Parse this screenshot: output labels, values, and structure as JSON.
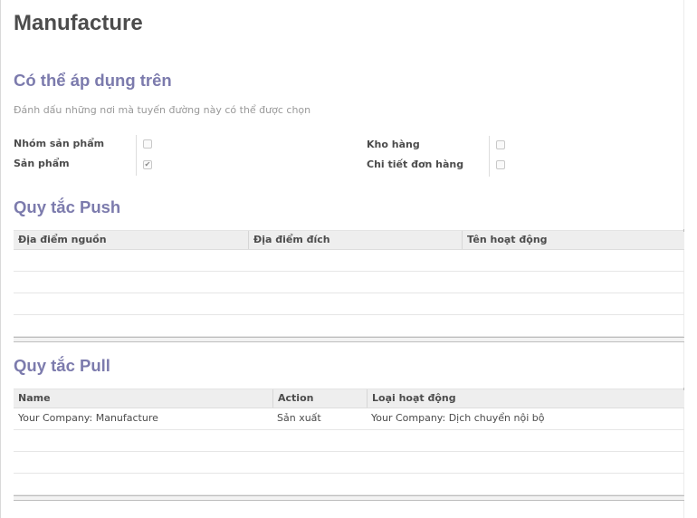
{
  "page": {
    "title": "Manufacture"
  },
  "applicable": {
    "title": "Có thể áp dụng trên",
    "hint": "Đánh dấu những nơi mà tuyến đường này có thể được chọn",
    "fields": [
      {
        "label": "Nhóm sản phẩm",
        "checked": false
      },
      {
        "label": "Sản phẩm",
        "checked": true
      },
      {
        "label": "Kho hàng",
        "checked": false
      },
      {
        "label": "Chi tiết đơn hàng",
        "checked": false
      }
    ]
  },
  "push": {
    "title": "Quy tắc Push",
    "columns": [
      "Địa điểm nguồn",
      "Địa điểm đích",
      "Tên hoạt động"
    ],
    "rows": []
  },
  "pull": {
    "title": "Quy tắc Pull",
    "columns": [
      "Name",
      "Action",
      "Loại hoạt động"
    ],
    "rows": [
      [
        "Your Company: Manufacture",
        "Sản xuất",
        "Your Company: Dịch chuyển nội bộ"
      ]
    ]
  },
  "icons": {
    "checkmark": "✔"
  }
}
